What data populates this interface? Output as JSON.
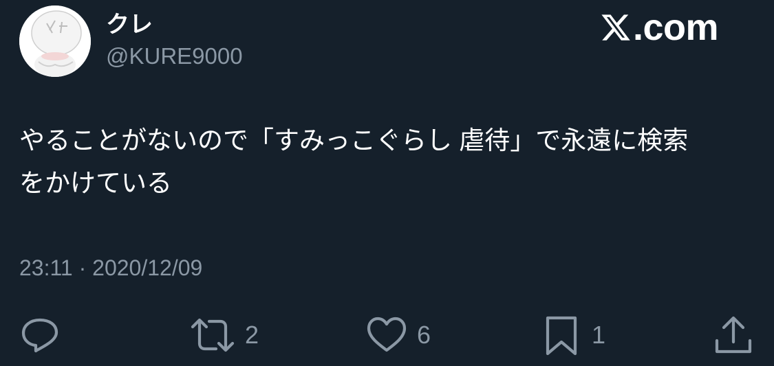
{
  "author": {
    "display_name": "クレ",
    "handle": "@KURE9000"
  },
  "brand": {
    "text": ".com",
    "icon": "x-logo-icon"
  },
  "tweet": {
    "text": "やることがないので「すみっこぐらし 虐待」で永遠に検索\nをかけている",
    "timestamp": "23:11 · 2020/12/09"
  },
  "actions": {
    "reply": {
      "icon": "reply-icon"
    },
    "retweet": {
      "icon": "retweet-icon",
      "count": "2"
    },
    "like": {
      "icon": "heart-icon",
      "count": "6"
    },
    "bookmark": {
      "icon": "bookmark-icon",
      "count": "1"
    },
    "share": {
      "icon": "share-icon"
    }
  },
  "colors": {
    "background": "#15202b",
    "text_primary": "#ffffff",
    "text_secondary": "#8b98a5"
  }
}
